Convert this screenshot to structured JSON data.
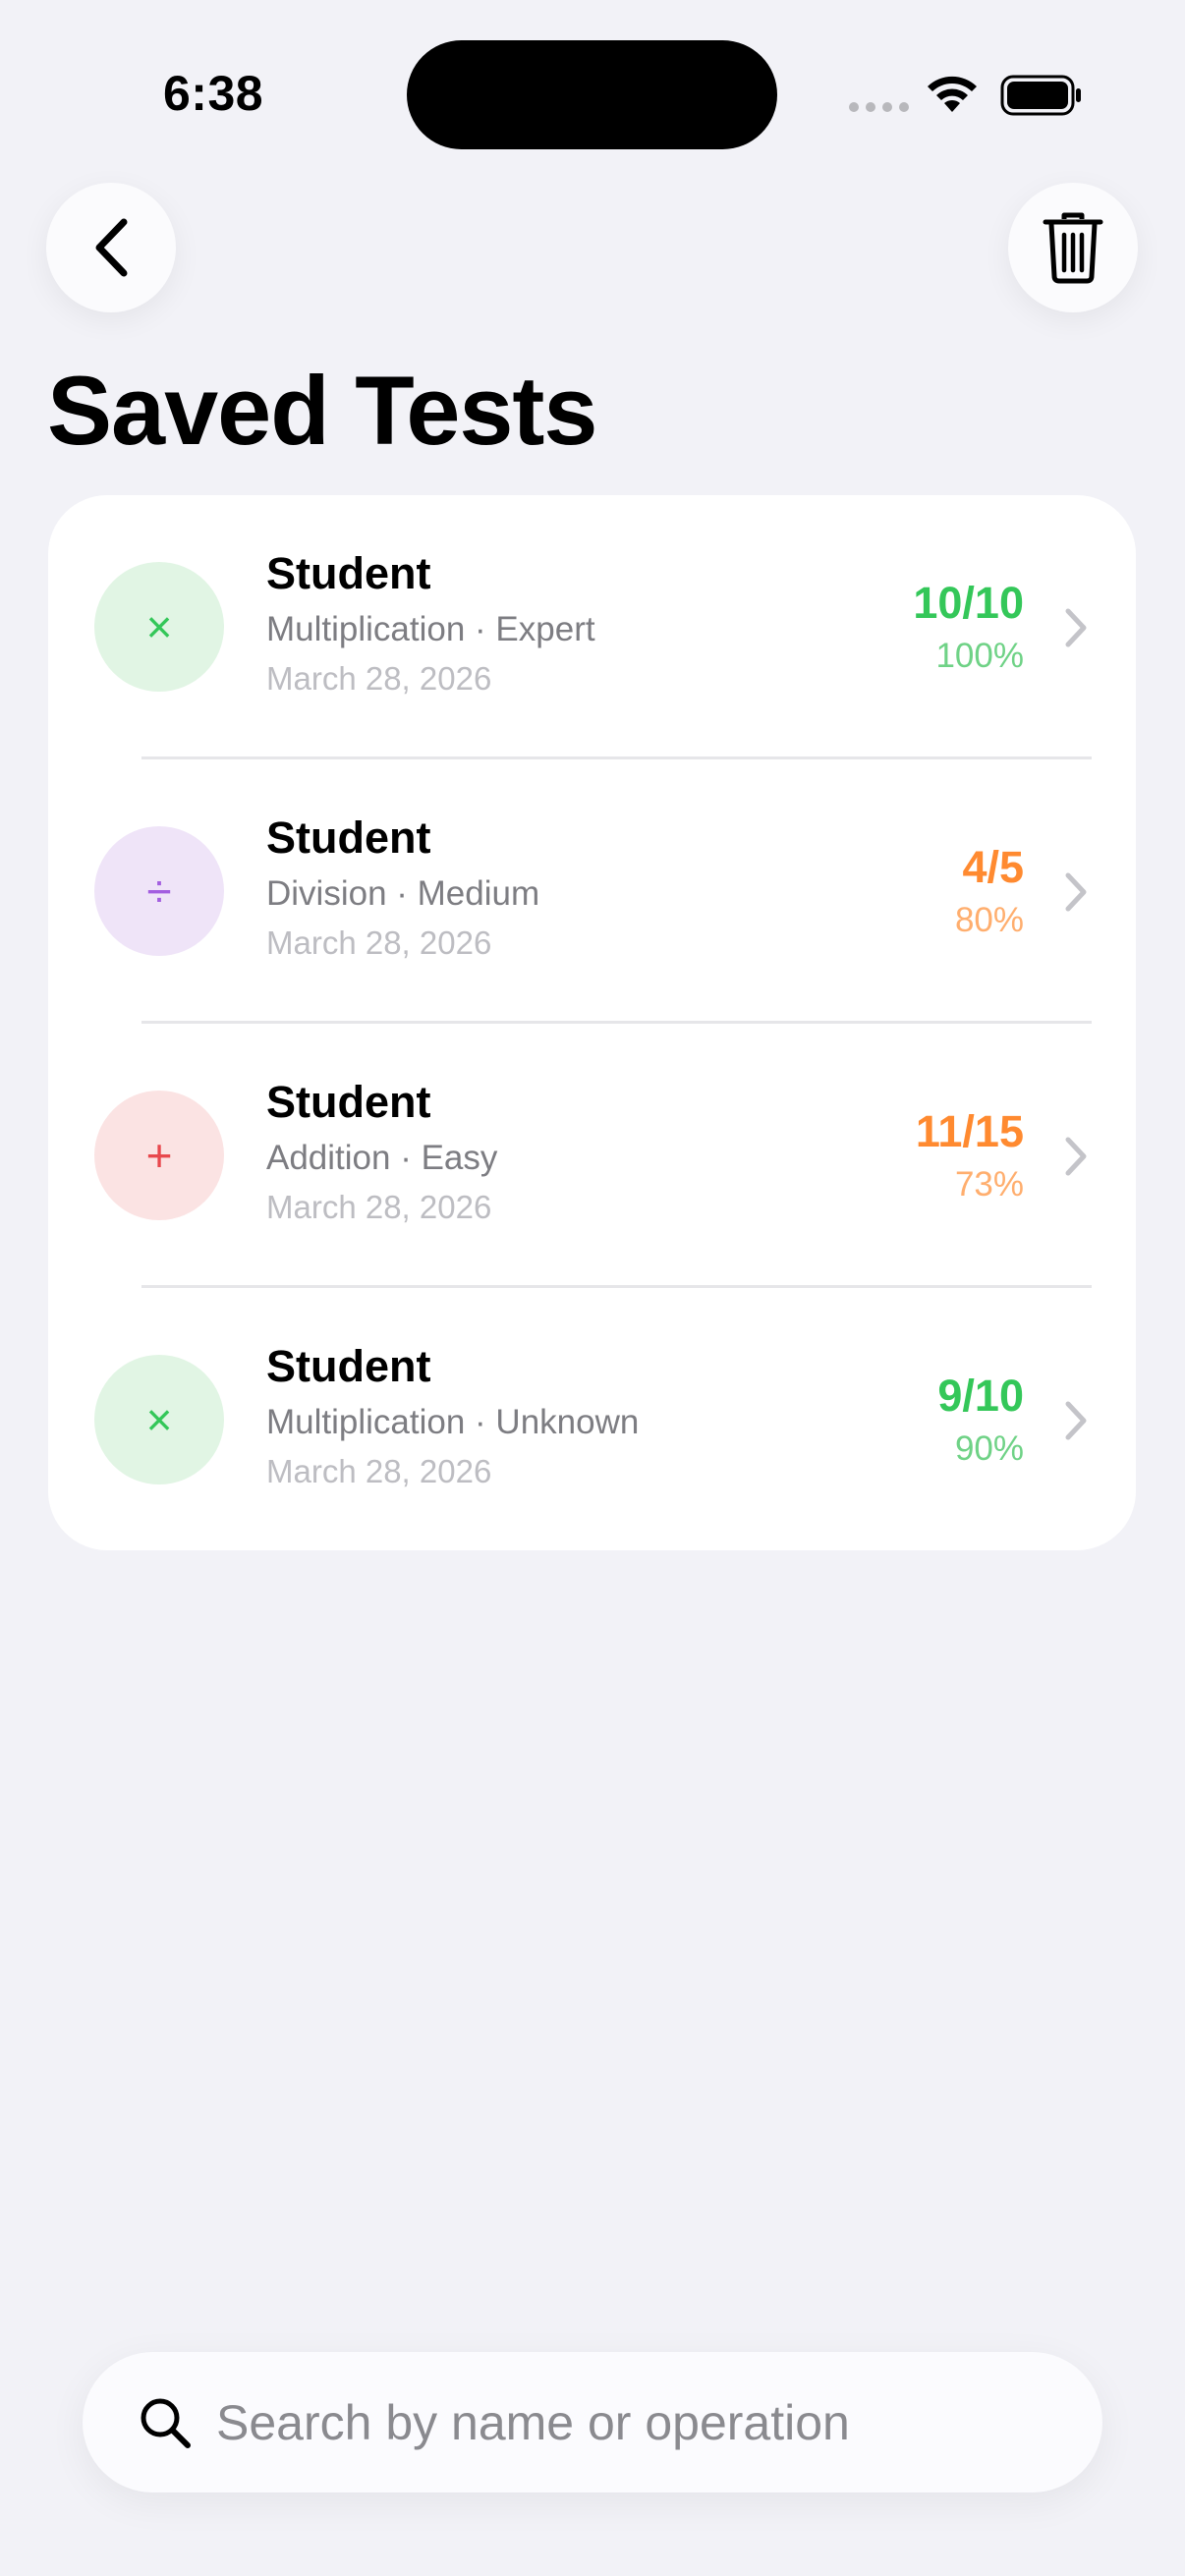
{
  "status_bar": {
    "time": "6:38"
  },
  "header": {
    "title": "Saved Tests"
  },
  "tests": [
    {
      "name": "Student",
      "subtitle": "Multiplication · Expert",
      "date": "March 28, 2026",
      "score": "10/10",
      "percent": "100%",
      "operation_symbol": "×",
      "operation_icon": "multiply-icon",
      "score_color": "#34c759",
      "percent_color": "#6fd286",
      "icon_bg": "#e1f5e4",
      "icon_color": "#34c759"
    },
    {
      "name": "Student",
      "subtitle": "Division · Medium",
      "date": "March 28, 2026",
      "score": "4/5",
      "percent": "80%",
      "operation_symbol": "÷",
      "operation_icon": "divide-icon",
      "score_color": "#ff8a30",
      "percent_color": "#ffae6e",
      "icon_bg": "#efe4f8",
      "icon_color": "#a35ee0"
    },
    {
      "name": "Student",
      "subtitle": "Addition · Easy",
      "date": "March 28, 2026",
      "score": "11/15",
      "percent": "73%",
      "operation_symbol": "+",
      "operation_icon": "plus-icon",
      "score_color": "#ff8a30",
      "percent_color": "#ffae6e",
      "icon_bg": "#fbe3e3",
      "icon_color": "#e8484d"
    },
    {
      "name": "Student",
      "subtitle": "Multiplication · Unknown",
      "date": "March 28, 2026",
      "score": "9/10",
      "percent": "90%",
      "operation_symbol": "×",
      "operation_icon": "multiply-icon",
      "score_color": "#34c759",
      "percent_color": "#6fd286",
      "icon_bg": "#e1f5e4",
      "icon_color": "#34c759"
    }
  ],
  "search": {
    "placeholder": "Search by name or operation",
    "value": ""
  }
}
